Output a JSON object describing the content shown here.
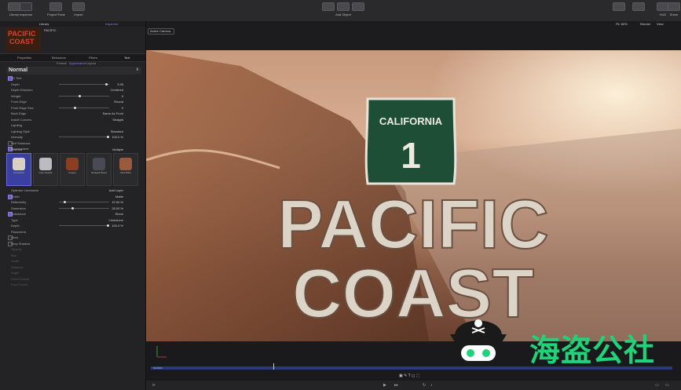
{
  "toolbar": {
    "library": "Library",
    "inspector": "Inspector",
    "project_pane": "Project Pane",
    "import": "Import",
    "add_object": "Add Object",
    "hud": "HUD",
    "share": "Share"
  },
  "left_panel": {
    "tabs": {
      "library": "Library",
      "inspector": "Inspector"
    },
    "preview_name": "PACIFIC",
    "preview_logo": [
      "PACIFIC",
      "COAST"
    ],
    "inspector_tabs": [
      "Properties",
      "Behaviors",
      "Filters",
      "Text"
    ],
    "sub_tabs": [
      "Format",
      "Appearance",
      "Layout"
    ],
    "preset": "Normal",
    "rows": [
      {
        "label": "3D Text",
        "value": "",
        "check": true
      },
      {
        "label": "Depth",
        "value": "3.95",
        "slider": 0.95
      },
      {
        "label": "Depth Direction",
        "value": "Centered"
      },
      {
        "label": "Weight",
        "value": "0",
        "slider": 0.4
      },
      {
        "label": "Front Edge",
        "value": "Round"
      },
      {
        "label": "Front Edge Size",
        "value": "0",
        "slider": 0.3
      },
      {
        "label": "Back Edge",
        "value": "Same As Front"
      },
      {
        "label": "Inside Corners",
        "value": "Straight"
      },
      {
        "label": "Lighting",
        "value": ""
      },
      {
        "label": "Lighting Style",
        "value": "Standard"
      },
      {
        "label": "Intensity",
        "value": "100.0 %",
        "slider": 0.98
      },
      {
        "label": "Self Shadows",
        "value": "",
        "check": false
      },
      {
        "label": "Environment",
        "value": "",
        "check": true
      }
    ],
    "material": {
      "label": "Material",
      "value": "Multiple"
    },
    "materials": [
      {
        "name": "Limestone",
        "color": "#d8d0c4"
      },
      {
        "name": "Gray Granite",
        "color": "#bcbcc0"
      },
      {
        "name": "Copper",
        "color": "#8a3e22"
      },
      {
        "name": "Scraped Wood",
        "color": "#4a4a55"
      },
      {
        "name": "Red Brick",
        "color": "#9a5a3e"
      }
    ],
    "rows2": [
      {
        "label": "Optimize Limestone",
        "value": "Add Layer"
      },
      {
        "label": "Finish",
        "value": "Matte",
        "check": true
      },
      {
        "label": "Reflectivity",
        "value": "10.00 %",
        "slider": 0.1
      },
      {
        "label": "Dimension",
        "value": "28.00 %",
        "slider": 0.25
      },
      {
        "label": "Substance",
        "value": "Stone",
        "check": true
      },
      {
        "label": "Type",
        "value": "Limestone"
      },
      {
        "label": "Depth",
        "value": "100.0 %",
        "slider": 0.98
      },
      {
        "label": "Placement",
        "value": ""
      },
      {
        "label": "Glow",
        "value": "",
        "check": false
      },
      {
        "label": "Drop Shadow",
        "value": "",
        "check": false
      }
    ],
    "rows3": [
      "Opacity",
      "Blur",
      "Scale",
      "Distance",
      "Angle",
      "Fixed Source",
      "Four Corner"
    ]
  },
  "viewer": {
    "camera": "Active Camera",
    "zoom": "Fit: 80%",
    "render": "Render",
    "view": "View",
    "sign_state": "CALIFORNIA",
    "sign_number": "1",
    "title_line1": "PACIFIC",
    "title_line2": "COAST",
    "timeline_label": "PACIFIC"
  },
  "watermark": {
    "text": "海盗公社"
  },
  "colors": {
    "accent": "#6a5acd",
    "timeline": "#2b3a78",
    "shield_green": "#1f4e36"
  }
}
